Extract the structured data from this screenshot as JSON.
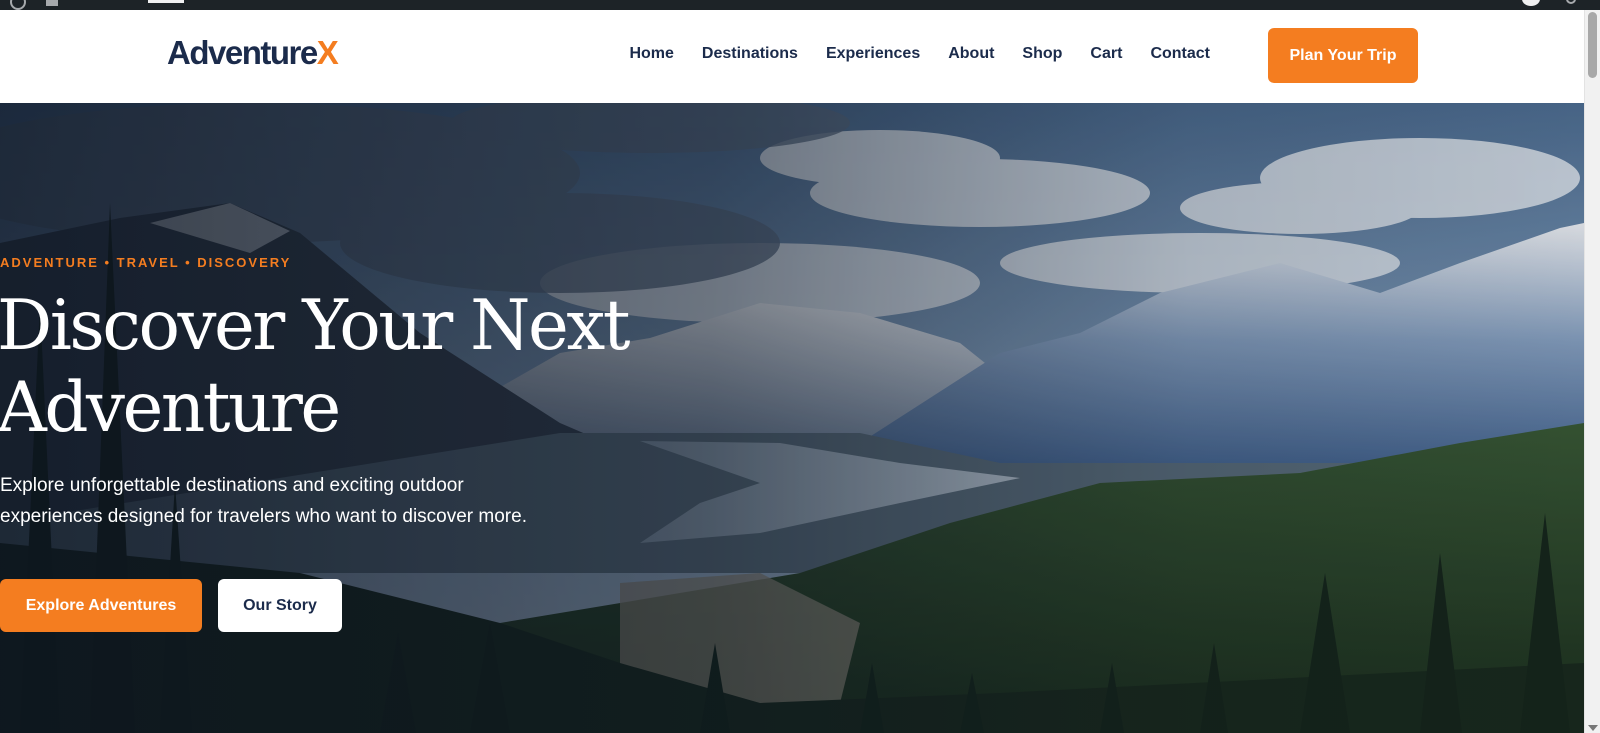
{
  "brand": {
    "name": "Adventure",
    "accent_letter": "X",
    "accent_color": "#f47d20",
    "name_color": "#1b2b4b"
  },
  "nav": {
    "items": [
      "Home",
      "Destinations",
      "Experiences",
      "About",
      "Shop",
      "Cart",
      "Contact"
    ],
    "cta_label": "Plan Your Trip"
  },
  "hero": {
    "eyebrow": "ADVENTURE • TRAVEL • DISCOVERY",
    "headline": "Discover Your Next Adventure",
    "subtext": "Explore unforgettable destinations and exciting outdoor experiences designed for travelers who want to discover more.",
    "primary_button": "Explore Adventures",
    "secondary_button": "Our Story",
    "background_image": "mountain-valley-forest-photo"
  },
  "icons": {
    "admin_logo": "wordpress-icon",
    "account": "user-avatar-icon",
    "search": "search-icon"
  }
}
